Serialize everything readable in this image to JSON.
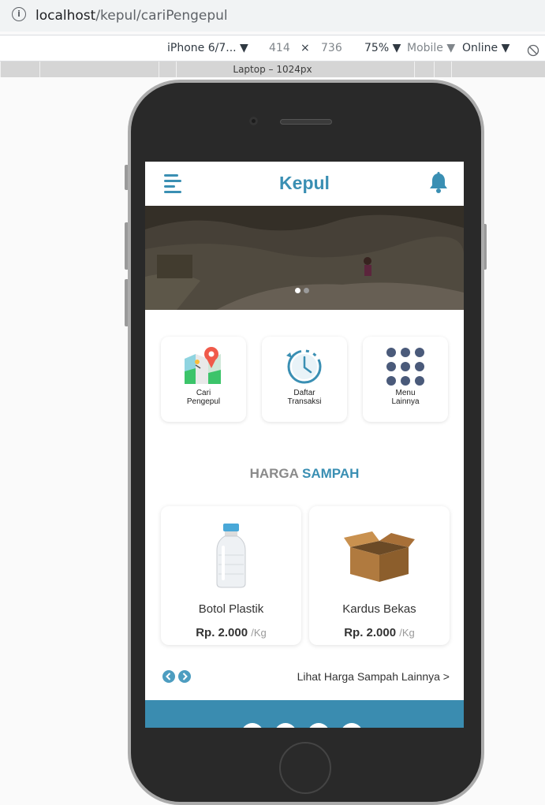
{
  "browser": {
    "url_host": "localhost",
    "url_path": "/kepul/cariPengepul"
  },
  "device_toolbar": {
    "device": "iPhone 6/7...",
    "width": "414",
    "times": "×",
    "height": "736",
    "zoom": "75%",
    "mode": "Mobile",
    "network": "Online"
  },
  "media_query": {
    "label": "Laptop – 1024px"
  },
  "app": {
    "title": "Kepul",
    "menu": [
      {
        "label": "Cari\nPengepul",
        "icon": "map-pin-icon"
      },
      {
        "label": "Daftar\nTransaksi",
        "icon": "history-clock-icon"
      },
      {
        "label": "Menu\nLainnya",
        "icon": "grid-dots-icon"
      }
    ],
    "harga": {
      "part1": "HARGA",
      "part2": "SAMPAH"
    },
    "products": [
      {
        "name": "Botol Plastik",
        "price": "Rp. 2.000",
        "unit": "/Kg",
        "icon": "plastic-bottle-icon"
      },
      {
        "name": "Kardus Bekas",
        "price": "Rp. 2.000",
        "unit": "/Kg",
        "icon": "cardboard-box-icon"
      }
    ],
    "more_link": "Lihat Harga Sampah Lainnya >",
    "banner_slides": 2,
    "banner_active_slide": 1
  },
  "colors": {
    "primary": "#3a8fb3",
    "muted_heading": "#8a8a8a",
    "bottom_bar": "#3a8cb0"
  }
}
